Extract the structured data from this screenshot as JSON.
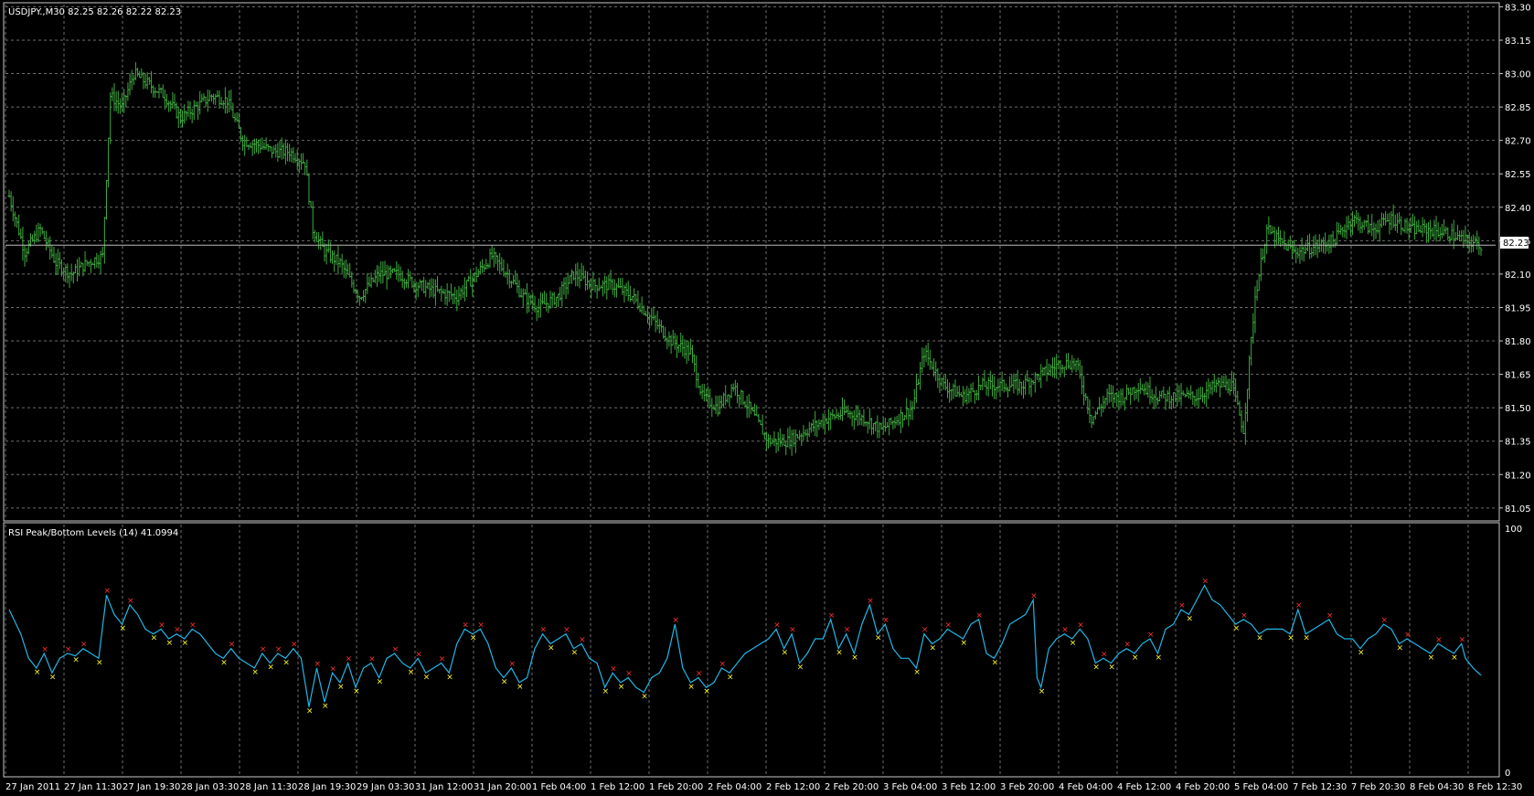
{
  "colors": {
    "background": "#000000",
    "grid": "#6e6e6e",
    "frame": "#c8c8c8",
    "price_bars": "#3faa3f",
    "rsi_line": "#21b7e6",
    "peak_marker": "#ff3030",
    "bottom_marker": "#ffff33",
    "text": "#ffffff",
    "current_price_tag_bg": "#ffffff",
    "current_price_tag_text": "#000000"
  },
  "main_panel": {
    "header": "USDJPY.,M30  82.25 82.26 82.22 82.23",
    "price_axis_labels": [
      "83.30",
      "83.15",
      "83.00",
      "82.85",
      "82.70",
      "82.55",
      "82.40",
      "82.25",
      "82.10",
      "81.95",
      "81.80",
      "81.65",
      "81.50",
      "81.35",
      "81.20",
      "81.05"
    ],
    "current_price": "82.23"
  },
  "rsi_panel": {
    "header": "RSI Peak/Bottom Levels (14)  41.0994",
    "axis_labels": [
      "100",
      "0"
    ]
  },
  "time_axis_labels": [
    "27 Jan 2011",
    "27 Jan 11:30",
    "27 Jan 19:30",
    "28 Jan 03:30",
    "28 Jan 11:30",
    "28 Jan 19:30",
    "29 Jan 03:30",
    "31 Jan 12:00",
    "31 Jan 20:00",
    "1 Feb 04:00",
    "1 Feb 12:00",
    "1 Feb 20:00",
    "2 Feb 04:00",
    "2 Feb 12:00",
    "2 Feb 20:00",
    "3 Feb 04:00",
    "3 Feb 12:00",
    "3 Feb 20:00",
    "4 Feb 04:00",
    "4 Feb 12:00",
    "4 Feb 20:00",
    "5 Feb 04:00",
    "7 Feb 12:30",
    "7 Feb 20:30",
    "8 Feb 04:30",
    "8 Feb 12:30"
  ],
  "chart_data": [
    {
      "type": "ohlc-bar",
      "title": "USDJPY.,M30",
      "ylim": [
        81.0,
        83.31
      ],
      "grid": true,
      "close_path": [
        [
          0,
          82.45
        ],
        [
          8,
          82.2
        ],
        [
          16,
          82.3
        ],
        [
          24,
          82.15
        ],
        [
          32,
          82.1
        ],
        [
          40,
          82.15
        ],
        [
          48,
          82.18
        ],
        [
          52,
          82.9
        ],
        [
          58,
          82.85
        ],
        [
          64,
          83.0
        ],
        [
          72,
          82.95
        ],
        [
          80,
          82.9
        ],
        [
          88,
          82.8
        ],
        [
          96,
          82.85
        ],
        [
          104,
          82.9
        ],
        [
          112,
          82.88
        ],
        [
          120,
          82.7
        ],
        [
          128,
          82.68
        ],
        [
          136,
          82.65
        ],
        [
          144,
          82.65
        ],
        [
          152,
          82.6
        ],
        [
          156,
          82.3
        ],
        [
          162,
          82.2
        ],
        [
          170,
          82.15
        ],
        [
          180,
          82.0
        ],
        [
          190,
          82.1
        ],
        [
          200,
          82.1
        ],
        [
          210,
          82.05
        ],
        [
          220,
          82.02
        ],
        [
          230,
          82.0
        ],
        [
          240,
          82.1
        ],
        [
          248,
          82.18
        ],
        [
          256,
          82.1
        ],
        [
          264,
          82.0
        ],
        [
          272,
          81.95
        ],
        [
          282,
          82.0
        ],
        [
          290,
          82.1
        ],
        [
          300,
          82.05
        ],
        [
          310,
          82.05
        ],
        [
          320,
          82.0
        ],
        [
          330,
          81.9
        ],
        [
          340,
          81.8
        ],
        [
          350,
          81.75
        ],
        [
          356,
          81.55
        ],
        [
          364,
          81.5
        ],
        [
          372,
          81.6
        ],
        [
          380,
          81.5
        ],
        [
          390,
          81.35
        ],
        [
          400,
          81.35
        ],
        [
          410,
          81.4
        ],
        [
          420,
          81.45
        ],
        [
          430,
          81.48
        ],
        [
          440,
          81.45
        ],
        [
          448,
          81.4
        ],
        [
          456,
          81.45
        ],
        [
          464,
          81.5
        ],
        [
          470,
          81.75
        ],
        [
          480,
          81.6
        ],
        [
          490,
          81.55
        ],
        [
          500,
          81.6
        ],
        [
          510,
          81.6
        ],
        [
          520,
          81.6
        ],
        [
          530,
          81.65
        ],
        [
          540,
          81.7
        ],
        [
          548,
          81.7
        ],
        [
          556,
          81.45
        ],
        [
          564,
          81.55
        ],
        [
          572,
          81.55
        ],
        [
          580,
          81.6
        ],
        [
          590,
          81.55
        ],
        [
          600,
          81.55
        ],
        [
          610,
          81.55
        ],
        [
          620,
          81.6
        ],
        [
          628,
          81.6
        ],
        [
          634,
          81.4
        ],
        [
          640,
          82.0
        ],
        [
          646,
          82.3
        ],
        [
          652,
          82.25
        ],
        [
          660,
          82.2
        ],
        [
          670,
          82.22
        ],
        [
          680,
          82.25
        ],
        [
          690,
          82.35
        ],
        [
          700,
          82.3
        ],
        [
          710,
          82.35
        ],
        [
          720,
          82.3
        ],
        [
          730,
          82.3
        ],
        [
          740,
          82.28
        ],
        [
          748,
          82.25
        ],
        [
          756,
          82.23
        ]
      ]
    },
    {
      "type": "line",
      "title": "RSI Peak/Bottom Levels (14)",
      "ylim": [
        0,
        100
      ],
      "grid": true,
      "rsi_path": [
        [
          0,
          68
        ],
        [
          6,
          58
        ],
        [
          10,
          48
        ],
        [
          14,
          44
        ],
        [
          18,
          50
        ],
        [
          22,
          42
        ],
        [
          26,
          48
        ],
        [
          30,
          50
        ],
        [
          34,
          49
        ],
        [
          38,
          52
        ],
        [
          42,
          50
        ],
        [
          46,
          48
        ],
        [
          50,
          74
        ],
        [
          54,
          66
        ],
        [
          58,
          62
        ],
        [
          62,
          70
        ],
        [
          66,
          66
        ],
        [
          70,
          60
        ],
        [
          74,
          58
        ],
        [
          78,
          60
        ],
        [
          82,
          56
        ],
        [
          86,
          58
        ],
        [
          90,
          56
        ],
        [
          94,
          60
        ],
        [
          98,
          58
        ],
        [
          102,
          54
        ],
        [
          106,
          50
        ],
        [
          110,
          48
        ],
        [
          114,
          52
        ],
        [
          118,
          48
        ],
        [
          122,
          46
        ],
        [
          126,
          44
        ],
        [
          130,
          50
        ],
        [
          134,
          46
        ],
        [
          138,
          50
        ],
        [
          142,
          48
        ],
        [
          146,
          52
        ],
        [
          150,
          48
        ],
        [
          154,
          28
        ],
        [
          158,
          44
        ],
        [
          162,
          30
        ],
        [
          166,
          42
        ],
        [
          170,
          38
        ],
        [
          174,
          46
        ],
        [
          178,
          36
        ],
        [
          182,
          44
        ],
        [
          186,
          46
        ],
        [
          190,
          40
        ],
        [
          194,
          48
        ],
        [
          198,
          50
        ],
        [
          202,
          46
        ],
        [
          206,
          44
        ],
        [
          210,
          48
        ],
        [
          214,
          42
        ],
        [
          218,
          44
        ],
        [
          222,
          46
        ],
        [
          226,
          42
        ],
        [
          230,
          54
        ],
        [
          234,
          60
        ],
        [
          238,
          58
        ],
        [
          242,
          60
        ],
        [
          246,
          54
        ],
        [
          250,
          44
        ],
        [
          254,
          40
        ],
        [
          258,
          44
        ],
        [
          262,
          38
        ],
        [
          266,
          40
        ],
        [
          270,
          52
        ],
        [
          274,
          58
        ],
        [
          278,
          54
        ],
        [
          282,
          56
        ],
        [
          286,
          58
        ],
        [
          290,
          52
        ],
        [
          294,
          54
        ],
        [
          298,
          48
        ],
        [
          302,
          46
        ],
        [
          306,
          36
        ],
        [
          310,
          42
        ],
        [
          314,
          38
        ],
        [
          318,
          40
        ],
        [
          322,
          36
        ],
        [
          326,
          34
        ],
        [
          330,
          40
        ],
        [
          334,
          42
        ],
        [
          338,
          48
        ],
        [
          342,
          62
        ],
        [
          346,
          44
        ],
        [
          350,
          38
        ],
        [
          354,
          40
        ],
        [
          358,
          36
        ],
        [
          362,
          38
        ],
        [
          366,
          44
        ],
        [
          370,
          42
        ],
        [
          374,
          46
        ],
        [
          378,
          50
        ],
        [
          382,
          52
        ],
        [
          386,
          54
        ],
        [
          390,
          56
        ],
        [
          394,
          60
        ],
        [
          398,
          52
        ],
        [
          402,
          58
        ],
        [
          406,
          46
        ],
        [
          410,
          50
        ],
        [
          414,
          56
        ],
        [
          418,
          56
        ],
        [
          422,
          64
        ],
        [
          426,
          52
        ],
        [
          430,
          58
        ],
        [
          434,
          50
        ],
        [
          438,
          62
        ],
        [
          442,
          70
        ],
        [
          446,
          58
        ],
        [
          450,
          62
        ],
        [
          454,
          52
        ],
        [
          458,
          48
        ],
        [
          462,
          48
        ],
        [
          466,
          44
        ],
        [
          470,
          58
        ],
        [
          474,
          54
        ],
        [
          478,
          56
        ],
        [
          482,
          60
        ],
        [
          486,
          58
        ],
        [
          490,
          56
        ],
        [
          494,
          62
        ],
        [
          498,
          64
        ],
        [
          502,
          50
        ],
        [
          506,
          48
        ],
        [
          510,
          54
        ],
        [
          514,
          62
        ],
        [
          518,
          64
        ],
        [
          522,
          66
        ],
        [
          526,
          72
        ],
        [
          528,
          40
        ],
        [
          530,
          36
        ],
        [
          534,
          52
        ],
        [
          538,
          56
        ],
        [
          542,
          58
        ],
        [
          546,
          56
        ],
        [
          550,
          60
        ],
        [
          554,
          56
        ],
        [
          558,
          46
        ],
        [
          562,
          48
        ],
        [
          566,
          46
        ],
        [
          570,
          50
        ],
        [
          574,
          52
        ],
        [
          578,
          50
        ],
        [
          582,
          54
        ],
        [
          586,
          56
        ],
        [
          590,
          50
        ],
        [
          594,
          60
        ],
        [
          598,
          62
        ],
        [
          602,
          68
        ],
        [
          606,
          66
        ],
        [
          610,
          72
        ],
        [
          614,
          78
        ],
        [
          618,
          72
        ],
        [
          622,
          70
        ],
        [
          626,
          66
        ],
        [
          630,
          62
        ],
        [
          634,
          64
        ],
        [
          638,
          62
        ],
        [
          642,
          58
        ],
        [
          646,
          60
        ],
        [
          650,
          60
        ],
        [
          654,
          60
        ],
        [
          658,
          58
        ],
        [
          662,
          68
        ],
        [
          666,
          58
        ],
        [
          670,
          60
        ],
        [
          674,
          62
        ],
        [
          678,
          64
        ],
        [
          682,
          58
        ],
        [
          686,
          56
        ],
        [
          690,
          56
        ],
        [
          694,
          52
        ],
        [
          698,
          56
        ],
        [
          702,
          58
        ],
        [
          706,
          62
        ],
        [
          710,
          60
        ],
        [
          714,
          54
        ],
        [
          718,
          56
        ],
        [
          722,
          54
        ],
        [
          726,
          52
        ],
        [
          730,
          50
        ],
        [
          734,
          54
        ],
        [
          738,
          52
        ],
        [
          742,
          50
        ],
        [
          746,
          54
        ],
        [
          748,
          48
        ],
        [
          752,
          44
        ],
        [
          756,
          41
        ]
      ]
    }
  ]
}
